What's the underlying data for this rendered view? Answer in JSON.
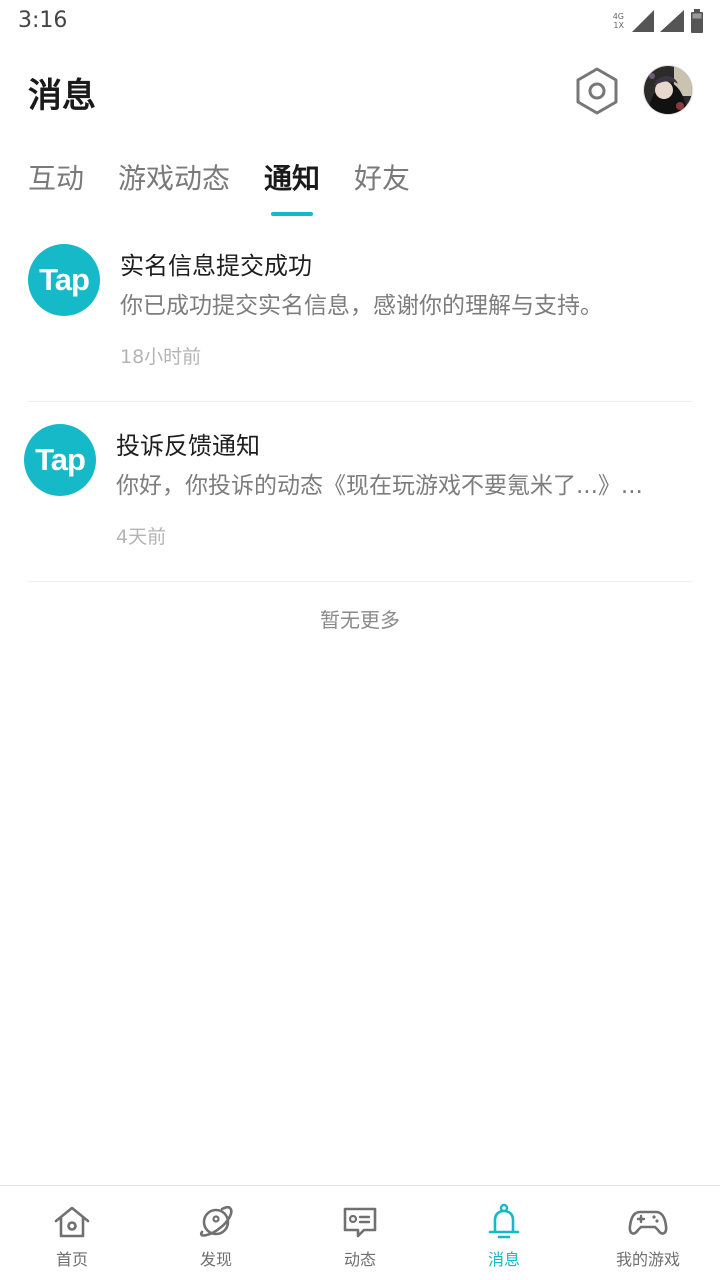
{
  "status_bar": {
    "time": "3:16",
    "net_top": "4G",
    "net_bottom": "1X"
  },
  "header": {
    "title": "消息",
    "settings_icon": "hexagon-settings-icon",
    "avatar_icon": "user-avatar"
  },
  "tabs": [
    {
      "label": "互动",
      "active": false
    },
    {
      "label": "游戏动态",
      "active": false
    },
    {
      "label": "通知",
      "active": true
    },
    {
      "label": "好友",
      "active": false
    }
  ],
  "notifications": [
    {
      "logo_text": "Tap",
      "title": "实名信息提交成功",
      "body": "你已成功提交实名信息，感谢你的理解与支持。",
      "time": "18小时前"
    },
    {
      "logo_text": "Tap",
      "title": "投诉反馈通知",
      "body": "你好，你投诉的动态《现在玩游戏不要氪米了...》...",
      "time": "4天前"
    }
  ],
  "footer_text": "暂无更多",
  "bottom_nav": [
    {
      "label": "首页",
      "icon": "home-icon",
      "active": false
    },
    {
      "label": "发现",
      "icon": "planet-icon",
      "active": false
    },
    {
      "label": "动态",
      "icon": "chat-card-icon",
      "active": false
    },
    {
      "label": "消息",
      "icon": "bell-icon",
      "active": true
    },
    {
      "label": "我的游戏",
      "icon": "gamepad-icon",
      "active": false
    }
  ],
  "colors": {
    "accent": "#14b9c8",
    "logo_bg": "#15b9c8",
    "text_primary": "#1a1a1a",
    "text_secondary": "#7d7d7d",
    "text_muted": "#b4b4b4"
  }
}
